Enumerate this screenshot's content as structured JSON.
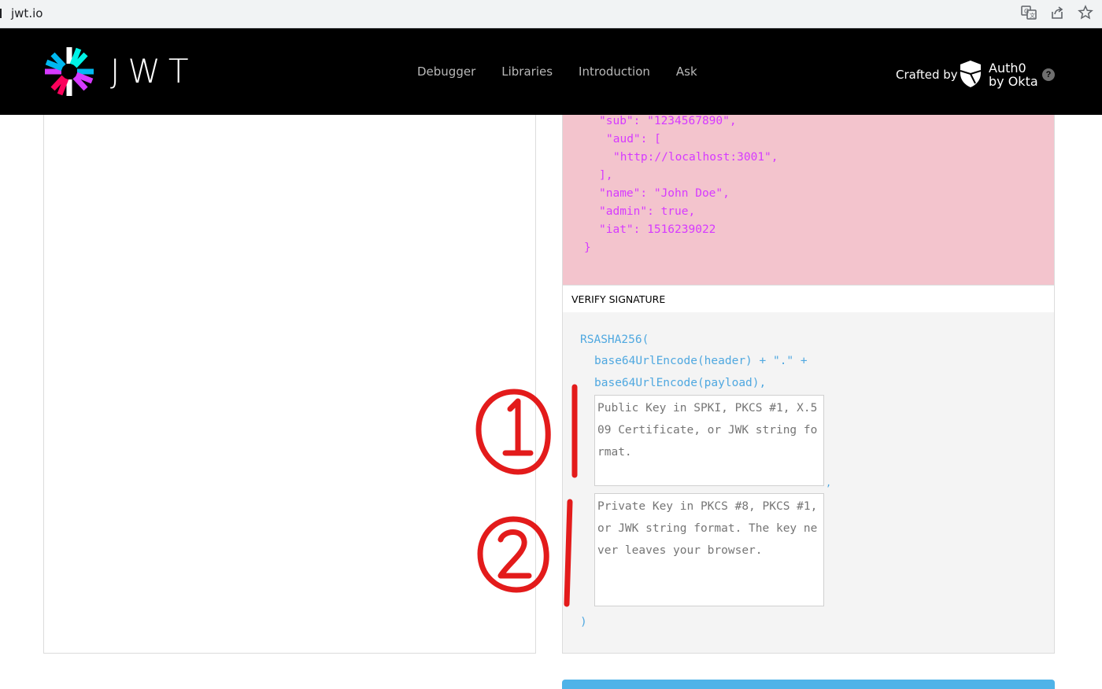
{
  "browser": {
    "url": "jwt.io",
    "icons": [
      "translate-icon",
      "share-icon",
      "bookmark-star-icon"
    ]
  },
  "header": {
    "logo_text": "JWT",
    "nav": [
      {
        "label": "Debugger"
      },
      {
        "label": "Libraries"
      },
      {
        "label": "Introduction"
      },
      {
        "label": "Ask"
      }
    ],
    "crafted_by": "Crafted by",
    "auth0_line1": "Auth0",
    "auth0_line2": "by Okta",
    "help": "?"
  },
  "payload": {
    "lines": [
      "\"sub\": \"1234567890\",",
      "\"aud\": [",
      "\"http://localhost:3001\",",
      "],",
      "\"name\": \"John Doe\",",
      "\"admin\": true,",
      "\"iat\": 1516239022",
      "}"
    ]
  },
  "verify": {
    "title": "VERIFY SIGNATURE",
    "line1": "RSASHA256(",
    "line2": "base64UrlEncode(header) + \".\" +",
    "line3": "base64UrlEncode(payload),",
    "public_key_placeholder": "Public Key in SPKI, PKCS #1, X.509 Certificate, or JWK string format.",
    "comma": ",",
    "private_key_placeholder": "Private Key in PKCS #8, PKCS #1, or JWK string format. The key never leaves your browser.",
    "close": ")"
  },
  "annotations": {
    "color": "#e31b1b",
    "marks": [
      "1",
      "2"
    ]
  },
  "colors": {
    "header_bg": "#000000",
    "payload_bg": "#f3c4cd",
    "payload_text": "#d63aff",
    "signature_text": "#4fa8e0",
    "button": "#4fb3e8"
  }
}
